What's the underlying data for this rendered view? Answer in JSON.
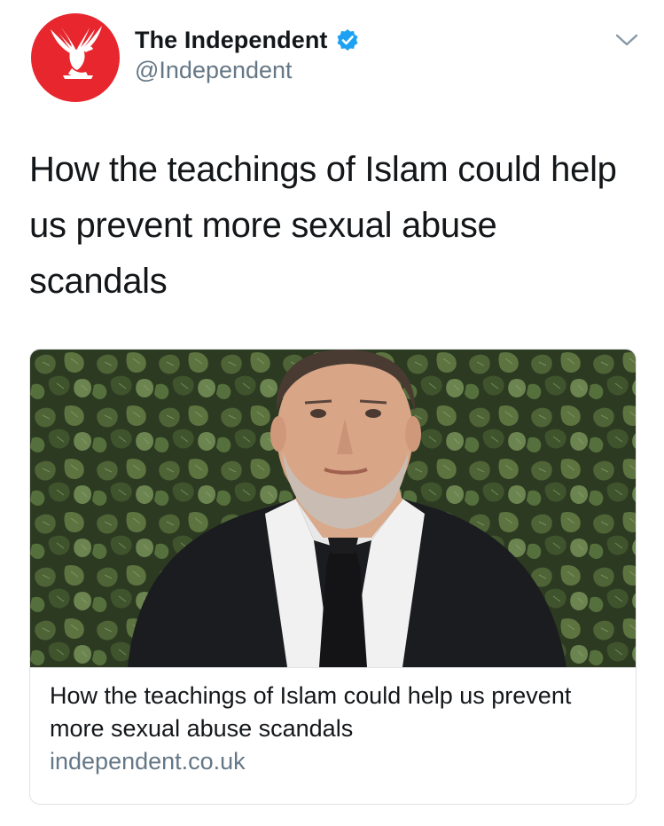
{
  "account": {
    "display_name": "The Independent",
    "handle": "@Independent",
    "verified": true,
    "avatar_icon": "independent-eagle-logo",
    "avatar_color": "#e8262e"
  },
  "tweet": {
    "text": "How the teachings of Islam could help us prevent more sexual abuse scandals"
  },
  "card": {
    "image_subject": "man in dark suit and tie in front of ivy leaf backdrop",
    "title": "How the teachings of Islam could help us prevent more sexual abuse scandals",
    "domain": "independent.co.uk"
  },
  "colors": {
    "text": "#14171a",
    "secondary": "#657786",
    "verified_blue": "#1da1f2",
    "border": "#dfe3e6"
  },
  "icons": {
    "menu": "chevron-down-icon",
    "verified": "verified-badge-icon"
  }
}
